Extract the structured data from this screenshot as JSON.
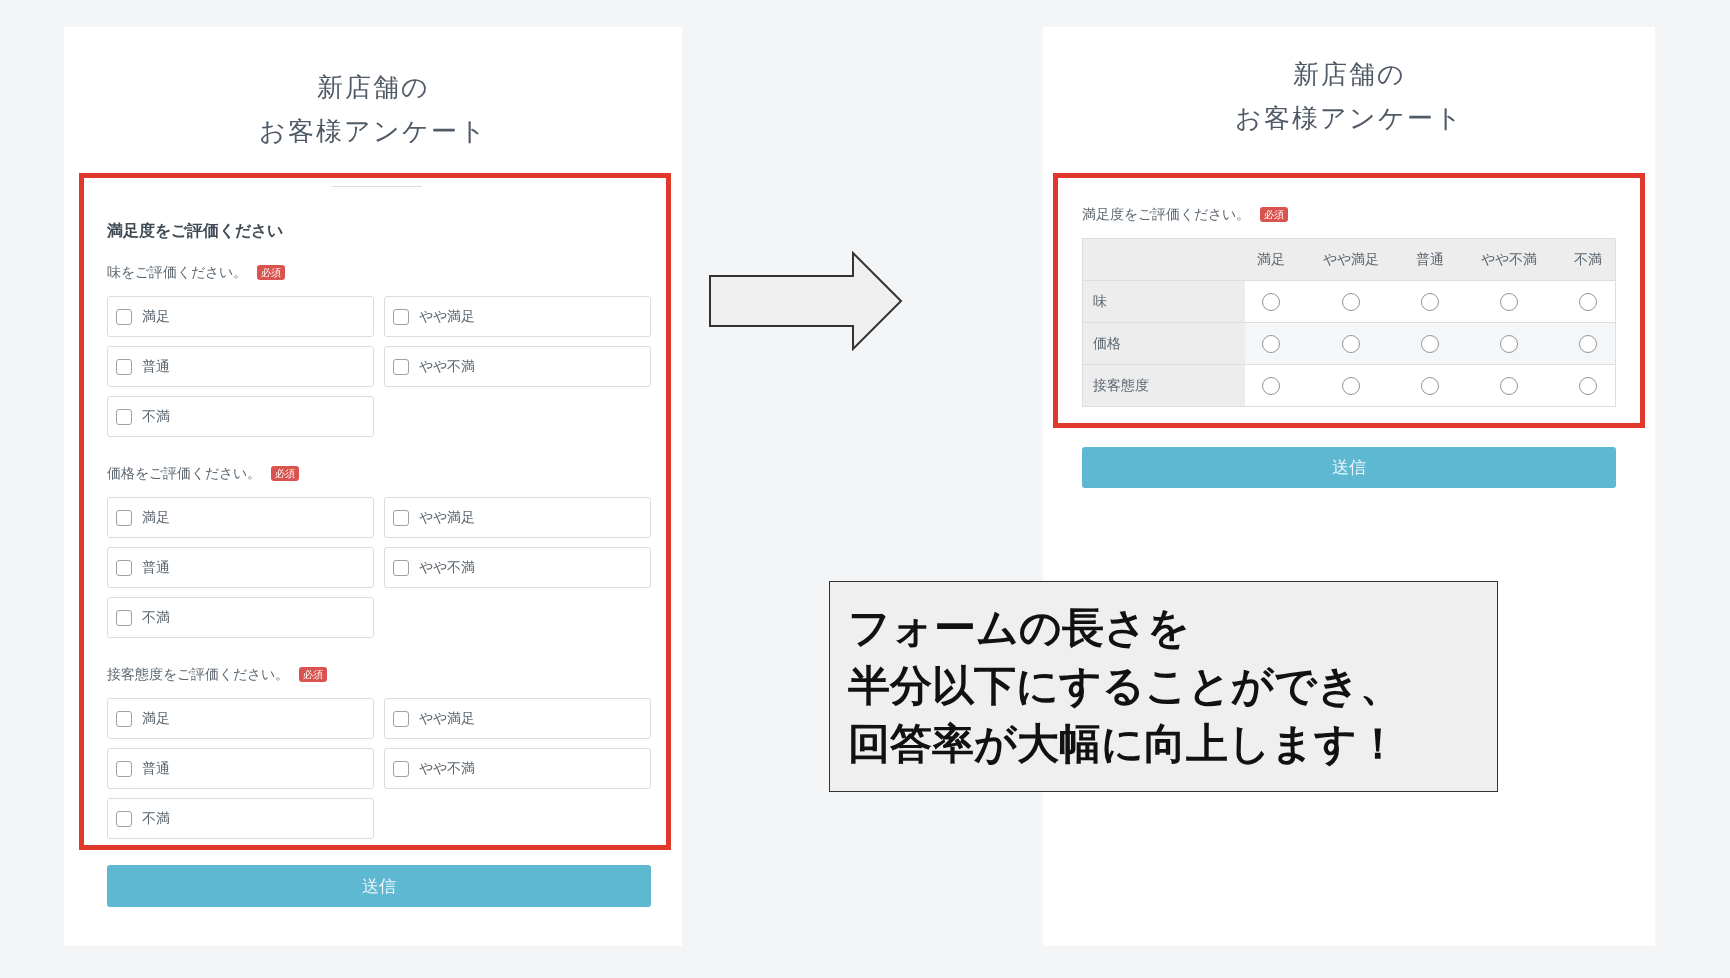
{
  "before_form": {
    "title_lines": [
      "新店舗の",
      "お客様アンケート"
    ],
    "section_heading": "満足度をご評価ください",
    "questions": [
      {
        "label": "味をご評価ください。",
        "badge": "必須",
        "options": [
          {
            "label": "満足",
            "checked": false
          },
          {
            "label": "やや満足",
            "checked": false
          },
          {
            "label": "普通",
            "checked": false
          },
          {
            "label": "やや不満",
            "checked": false
          },
          {
            "label": "不満",
            "checked": false
          }
        ]
      },
      {
        "label": "価格をご評価ください。",
        "badge": "必須",
        "options": [
          {
            "label": "満足",
            "checked": false
          },
          {
            "label": "やや満足",
            "checked": false
          },
          {
            "label": "普通",
            "checked": false
          },
          {
            "label": "やや不満",
            "checked": false
          },
          {
            "label": "不満",
            "checked": false
          }
        ]
      },
      {
        "label": "接客態度をご評価ください。",
        "badge": "必須",
        "options": [
          {
            "label": "満足",
            "checked": false
          },
          {
            "label": "やや満足",
            "checked": false
          },
          {
            "label": "普通",
            "checked": false
          },
          {
            "label": "やや不満",
            "checked": false
          },
          {
            "label": "不満",
            "checked": false
          }
        ]
      }
    ],
    "submit": "送信"
  },
  "after_form": {
    "title_lines": [
      "新店舗の",
      "お客様アンケート"
    ],
    "question": "満足度をご評価ください。",
    "badge": "必須",
    "columns": [
      "満足",
      "やや満足",
      "普通",
      "やや不満",
      "不満"
    ],
    "rows": [
      {
        "label": "味",
        "choices": [
          {
            "selected": false
          },
          {
            "selected": false
          },
          {
            "selected": false
          },
          {
            "selected": false
          },
          {
            "selected": false
          }
        ]
      },
      {
        "label": "価格",
        "choices": [
          {
            "selected": false
          },
          {
            "selected": false
          },
          {
            "selected": false
          },
          {
            "selected": false
          },
          {
            "selected": false
          }
        ]
      },
      {
        "label": "接客態度",
        "choices": [
          {
            "selected": false
          },
          {
            "selected": false
          },
          {
            "selected": false
          },
          {
            "selected": false
          },
          {
            "selected": false
          }
        ]
      }
    ],
    "submit": "送信"
  },
  "callout": {
    "lines": [
      "フォームの長さを",
      "半分以下にすることができ、",
      "回答率が大幅に向上します！"
    ]
  }
}
